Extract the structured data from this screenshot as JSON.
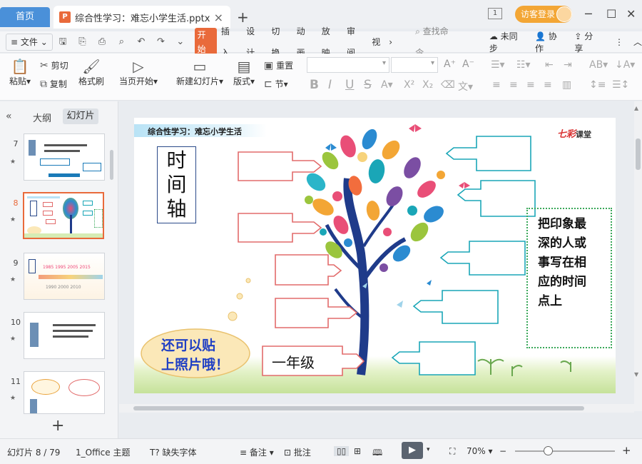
{
  "tabs": {
    "home": "首页",
    "document": "综合性学习：难忘小学生活.pptx",
    "new_tab": "+"
  },
  "titlebar": {
    "badge": "1",
    "login": "访客登录"
  },
  "menu": {
    "file": "文件",
    "items": [
      "开始",
      "插入",
      "设计",
      "切换",
      "动画",
      "放映",
      "审阅",
      "视"
    ],
    "search_placeholder": "查找命令...",
    "sync": "未同步",
    "collab": "协作",
    "share": "分享"
  },
  "ribbon": {
    "paste": "粘贴",
    "cut": "剪切",
    "copy": "复制",
    "format_painter": "格式刷",
    "play_from_current": "当页开始",
    "new_slide": "新建幻灯片",
    "layout": "版式",
    "reset": "重置",
    "section": "节",
    "bold": "B",
    "italic": "I",
    "underline": "U",
    "strike": "S"
  },
  "left_panel": {
    "tab_outline": "大纲",
    "tab_slides": "幻灯片",
    "slide_numbers": [
      "7",
      "8",
      "9",
      "10",
      "11"
    ],
    "selected": "8"
  },
  "slide": {
    "title": "综合性学习：难忘小学生活",
    "logo_main": "七彩",
    "logo_sub": "课堂",
    "time_axis": [
      "时",
      "间",
      "轴"
    ],
    "instruction_lines": [
      "把印象最",
      "深的人或",
      "事写在相",
      "应的时间",
      "点上"
    ],
    "grade_label": "一年级",
    "cloud_lines": [
      "还可以贴",
      "上照片哦！"
    ]
  },
  "status": {
    "slide_counter": "幻灯片 8 / 79",
    "theme": "1_Office 主题",
    "missing_font": "缺失字体",
    "notes": "备注",
    "comments": "批注",
    "zoom": "70%"
  },
  "colors": {
    "accent_orange": "#e96a3b",
    "tab_blue": "#4a90d9",
    "red_box": "#e26b6b",
    "teal_box": "#1aa6b7",
    "dotted_green": "#3aa85a",
    "cloud_text": "#1f3fc4"
  }
}
